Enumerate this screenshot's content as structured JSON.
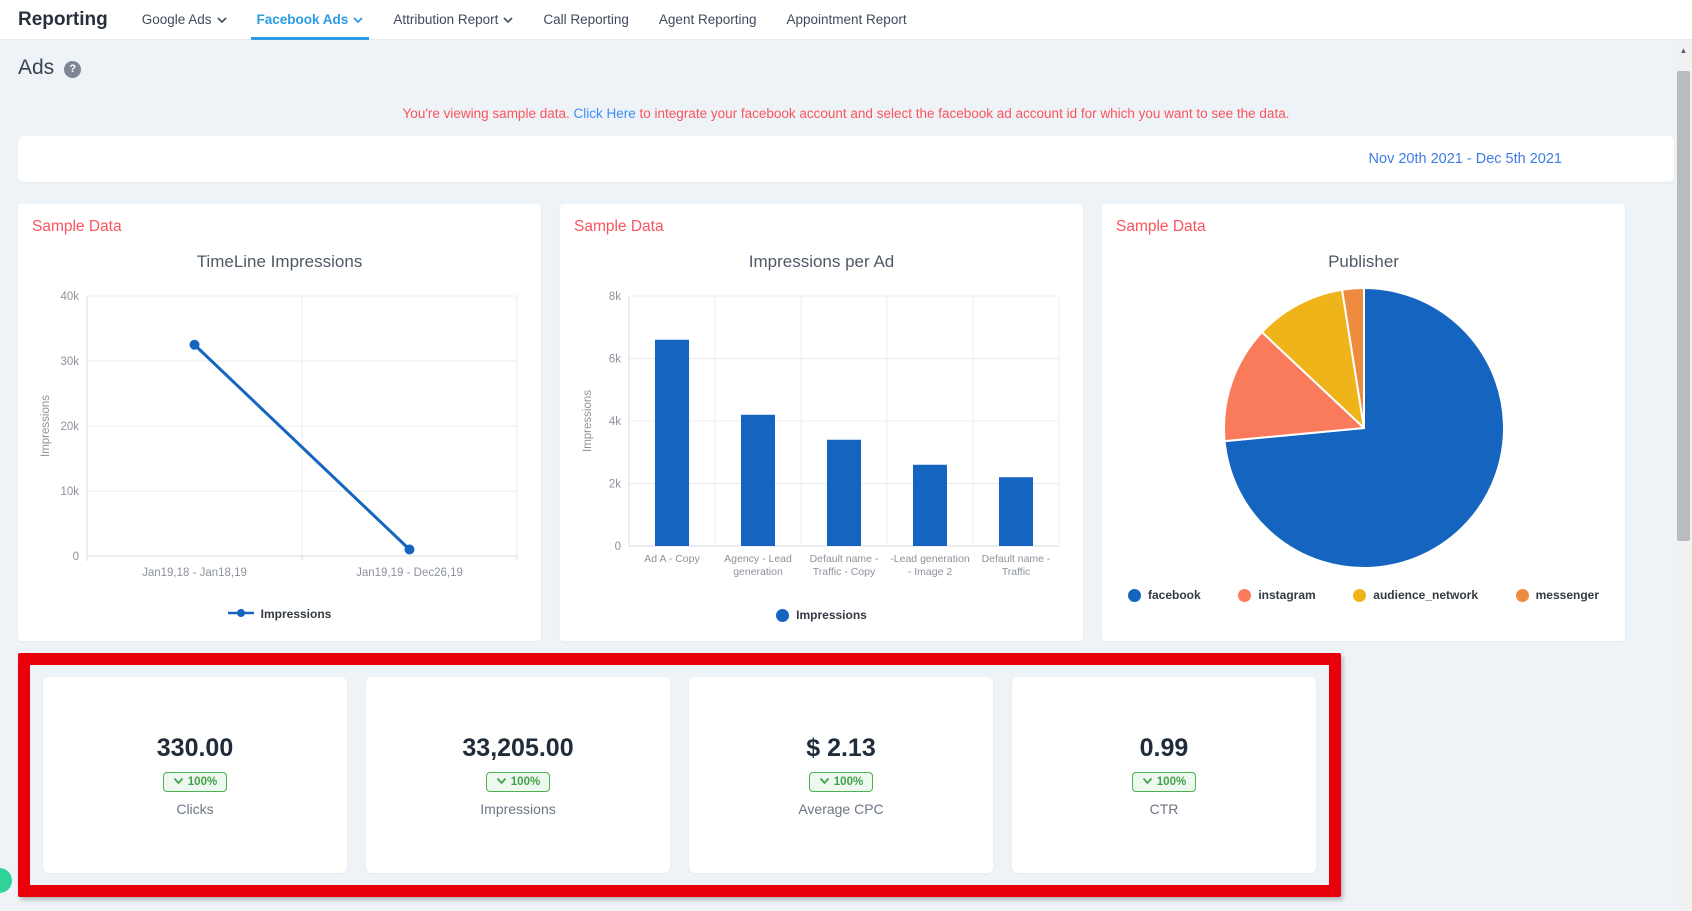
{
  "nav": {
    "title": "Reporting",
    "tabs": [
      {
        "label": "Google Ads",
        "has_dropdown": true,
        "active": false
      },
      {
        "label": "Facebook Ads",
        "has_dropdown": true,
        "active": true
      },
      {
        "label": "Attribution Report",
        "has_dropdown": true,
        "active": false
      },
      {
        "label": "Call Reporting",
        "has_dropdown": false,
        "active": false
      },
      {
        "label": "Agent Reporting",
        "has_dropdown": false,
        "active": false
      },
      {
        "label": "Appointment Report",
        "has_dropdown": false,
        "active": false
      }
    ]
  },
  "page": {
    "title": "Ads",
    "help_icon": "question-mark-circle-icon"
  },
  "banner": {
    "prefix": "You're viewing sample data.",
    "link": "Click Here",
    "suffix": "to integrate your facebook account and select the facebook ad account id for which you want to see the data."
  },
  "date_range": "Nov 20th 2021 - Dec 5th 2021",
  "sample_data_label": "Sample Data",
  "colors": {
    "accent_blue": "#2b9be4",
    "chart_blue": "#1565c0",
    "alert_red": "#fb545c",
    "highlight_frame_red": "#e8000b",
    "badge_green": "#4caf50",
    "link_blue": "#3e8ef7",
    "date_blue": "#3e7ce4"
  },
  "chart_data": [
    {
      "type": "line",
      "title": "TimeLine Impressions",
      "xlabel": "",
      "ylabel": "Impressions",
      "categories": [
        "Jan19,18 - Jan18,19",
        "Jan19,19 - Dec26,19"
      ],
      "series": [
        {
          "name": "Impressions",
          "values": [
            32500,
            1000
          ],
          "color": "#1565c0"
        }
      ],
      "ylim": [
        0,
        40000
      ],
      "yticks": [
        {
          "v": 0,
          "label": "0"
        },
        {
          "v": 10000,
          "label": "10k"
        },
        {
          "v": 20000,
          "label": "20k"
        },
        {
          "v": 30000,
          "label": "30k"
        },
        {
          "v": 40000,
          "label": "40k"
        }
      ],
      "grid": true,
      "legend_position": "bottom"
    },
    {
      "type": "bar",
      "title": "Impressions per Ad",
      "xlabel": "",
      "ylabel": "Impressions",
      "categories": [
        "Ad A - Copy",
        "Agency - Lead generation",
        "Default name - Traffic - Copy",
        "-Lead generation - Image 2",
        "Default name - Traffic"
      ],
      "values": [
        6600,
        4200,
        3400,
        2600,
        2200
      ],
      "bar_color": "#1565c0",
      "ylim": [
        0,
        8000
      ],
      "yticks": [
        {
          "v": 0,
          "label": "0"
        },
        {
          "v": 2000,
          "label": "2k"
        },
        {
          "v": 4000,
          "label": "4k"
        },
        {
          "v": 6000,
          "label": "6k"
        },
        {
          "v": 8000,
          "label": "8k"
        }
      ],
      "grid": true,
      "legend": [
        "Impressions"
      ],
      "legend_position": "bottom"
    },
    {
      "type": "pie",
      "title": "Publisher",
      "slices": [
        {
          "label": "facebook",
          "percent": 73.5,
          "color": "#1565c0"
        },
        {
          "label": "instagram",
          "percent": 13.5,
          "color": "#fa7b5c"
        },
        {
          "label": "audience_network",
          "percent": 10.5,
          "color": "#f0b41b"
        },
        {
          "label": "messenger",
          "percent": 2.5,
          "color": "#ee8b3f"
        }
      ],
      "legend_position": "bottom"
    }
  ],
  "stats": [
    {
      "value": "330.00",
      "change": "100%",
      "label": "Clicks"
    },
    {
      "value": "33,205.00",
      "change": "100%",
      "label": "Impressions"
    },
    {
      "value": "$ 2.13",
      "change": "100%",
      "label": "Average CPC"
    },
    {
      "value": "0.99",
      "change": "100%",
      "label": "CTR"
    }
  ],
  "scrollbar": {
    "up_arrow": "▲"
  }
}
